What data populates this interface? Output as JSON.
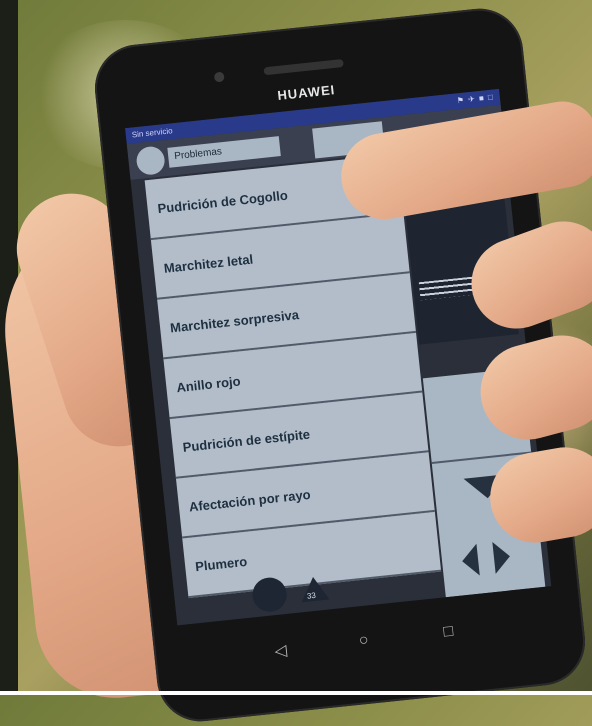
{
  "phone": {
    "brand": "HUAWEI"
  },
  "status_bar": {
    "carrier": "Sin servicio",
    "icons": "⚑ ✈ ■ □"
  },
  "app_bar": {
    "title": "Problemas"
  },
  "menu": {
    "items": [
      {
        "label": "Pudrición de Cogollo"
      },
      {
        "label": "Marchitez letal"
      },
      {
        "label": "Marchitez sorpresiva"
      },
      {
        "label": "Anillo rojo"
      },
      {
        "label": "Pudrición de estípite"
      },
      {
        "label": "Afectación por rayo"
      },
      {
        "label": "Plumero"
      }
    ]
  },
  "bottom": {
    "counter": "33"
  },
  "nav_keys": {
    "back": "◁",
    "home": "○",
    "recent": "□"
  },
  "colors": {
    "menu_item_bg": "#b3bdca",
    "menu_text": "#1e3040",
    "status_bar": "#2a3a8a"
  },
  "icons": [
    "back-icon",
    "home-icon",
    "recent-apps-icon",
    "arrow-down-icon",
    "arrow-left-icon",
    "arrow-right-icon"
  ]
}
